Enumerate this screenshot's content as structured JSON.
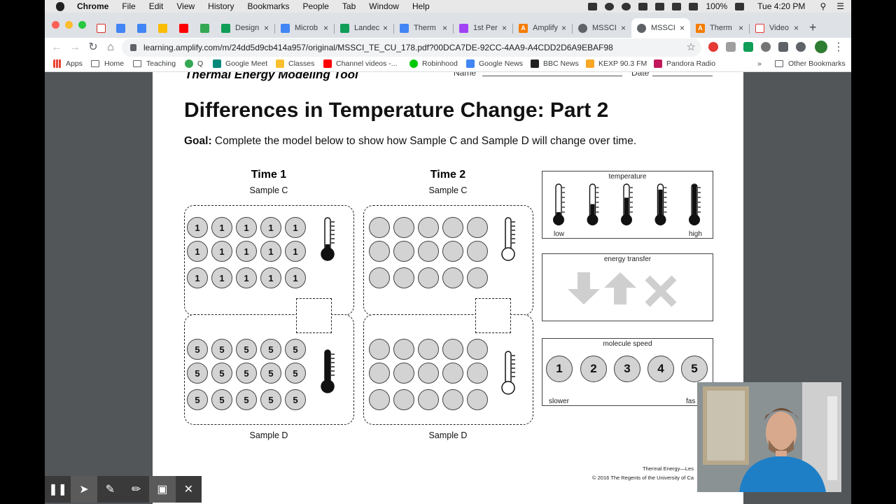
{
  "menubar": {
    "app": "Chrome",
    "items": [
      "File",
      "Edit",
      "View",
      "History",
      "Bookmarks",
      "People",
      "Tab",
      "Window",
      "Help"
    ],
    "battery": "100%",
    "clock": "Tue 4:20 PM"
  },
  "tabs": [
    {
      "label": "Design",
      "icon": "sheets-icon",
      "color": "#0f9d58"
    },
    {
      "label": "Microb",
      "icon": "docs-icon",
      "color": "#4285f4"
    },
    {
      "label": "Landec",
      "icon": "slides-icon",
      "color": "#0f9d58"
    },
    {
      "label": "Therm",
      "icon": "docs-icon",
      "color": "#4285f4"
    },
    {
      "label": "1st Per",
      "icon": "classroom-icon",
      "color": "#a142f4"
    },
    {
      "label": "Amplify",
      "icon": "amplify-icon",
      "color": "#f57c00"
    },
    {
      "label": "MSSCI",
      "icon": "globe-icon",
      "color": "#5f6368"
    },
    {
      "label": "MSSCI",
      "icon": "globe-icon",
      "color": "#5f6368"
    },
    {
      "label": "Therm",
      "icon": "amplify-icon",
      "color": "#f57c00"
    },
    {
      "label": "Video",
      "icon": "video-icon",
      "color": "#e53935"
    }
  ],
  "active_tab": 7,
  "url": "learning.amplify.com/m/24dd5d9cb414a957/original/MSSCI_TE_CU_178.pdf?00DCA7DE-92CC-4AA9-A4CDD2D6A9EBAF98",
  "bookmarks": [
    {
      "label": "Apps",
      "icon": "apps-icon"
    },
    {
      "label": "Home",
      "icon": "folder-icon"
    },
    {
      "label": "Teaching",
      "icon": "folder-icon"
    },
    {
      "label": "Q",
      "icon": "q-icon"
    },
    {
      "label": "Google Meet",
      "icon": "meet-icon"
    },
    {
      "label": "Classes",
      "icon": "classes-icon"
    },
    {
      "label": "Channel videos -...",
      "icon": "youtube-icon"
    },
    {
      "label": "Robinhood",
      "icon": "robinhood-icon"
    },
    {
      "label": "Google News",
      "icon": "news-icon"
    },
    {
      "label": "BBC News",
      "icon": "bbc-icon"
    },
    {
      "label": "KEXP 90.3 FM",
      "icon": "kexp-icon"
    },
    {
      "label": "Pandora Radio",
      "icon": "pandora-icon"
    }
  ],
  "other_bookmarks": "Other Bookmarks",
  "doc": {
    "tool_title": "Thermal Energy Modeling Tool",
    "name_label": "Name",
    "date_label": "Date",
    "title": "Differences in Temperature Change: Part 2",
    "goal_label": "Goal:",
    "goal_text": " Complete the model below to show how Sample C and Sample D will change over time.",
    "time1": "Time 1",
    "time2": "Time 2",
    "sample_c": "Sample C",
    "sample_d": "Sample D",
    "sample_c_speed_time1": "1",
    "sample_d_speed_time1": "5",
    "legend_temperature": "temperature",
    "legend_low": "low",
    "legend_high": "high",
    "legend_energy": "energy transfer",
    "legend_speed": "molecule speed",
    "speeds": [
      "1",
      "2",
      "3",
      "4",
      "5"
    ],
    "legend_slower": "slower",
    "legend_faster": "fas",
    "footer1": "Thermal Energy—Les",
    "footer2": "© 2016 The Regents of the University of Ca"
  }
}
